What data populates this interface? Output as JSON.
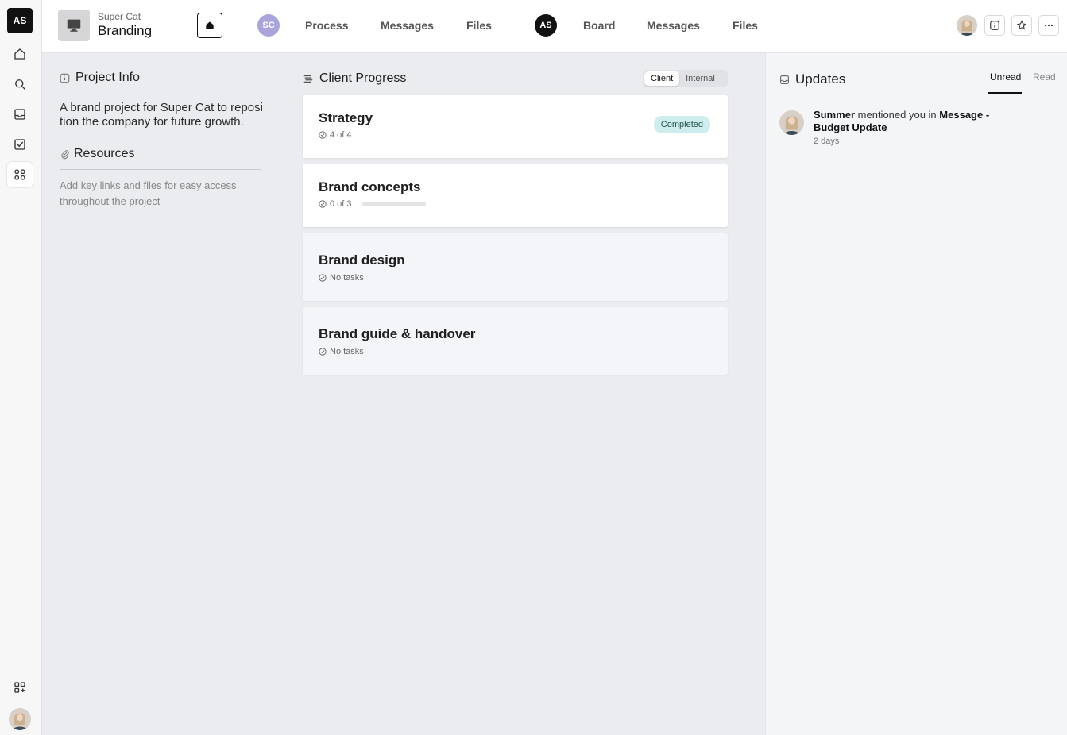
{
  "rail": {
    "logo": "AS",
    "items": [
      "home",
      "search",
      "inbox",
      "tasks",
      "apps"
    ],
    "bottom": [
      "add-apps"
    ]
  },
  "header": {
    "project_org": "Super Cat",
    "project_name": "Branding",
    "client_avatar": "SC",
    "client_nav": [
      "Process",
      "Messages",
      "Files"
    ],
    "team_avatar": "AS",
    "team_nav": [
      "Board",
      "Messages",
      "Files"
    ]
  },
  "project_info": {
    "title": "Project Info",
    "description": "A brand project for Super Cat to reposition the company for future growth.",
    "resources_title": "Resources",
    "resources_desc": "Add key links and files for easy access throughout the project"
  },
  "client_progress": {
    "title": "Client Progress",
    "toggle": [
      "Client",
      "Internal"
    ],
    "toggle_selected": "Client",
    "cards": [
      {
        "title": "Strategy",
        "meta": "4 of 4",
        "status": "Completed",
        "style": "white"
      },
      {
        "title": "Brand concepts",
        "meta": "0 of 3",
        "progress": 0,
        "style": "white"
      },
      {
        "title": "Brand design",
        "meta": "No tasks",
        "style": "grey"
      },
      {
        "title": "Brand guide & handover",
        "meta": "No tasks",
        "style": "grey"
      }
    ]
  },
  "updates": {
    "title": "Updates",
    "tabs": [
      "Unread",
      "Read"
    ],
    "selected_tab": "Unread",
    "items": [
      {
        "user": "Summer",
        "action": "mentioned you in",
        "target": "Message - Budget Update",
        "time": "2 days"
      }
    ]
  },
  "colors": {
    "accent_teal": "#3b9b8f",
    "badge_bg": "#cdeeec",
    "client_avatar_bg": "#a9a4dc"
  }
}
